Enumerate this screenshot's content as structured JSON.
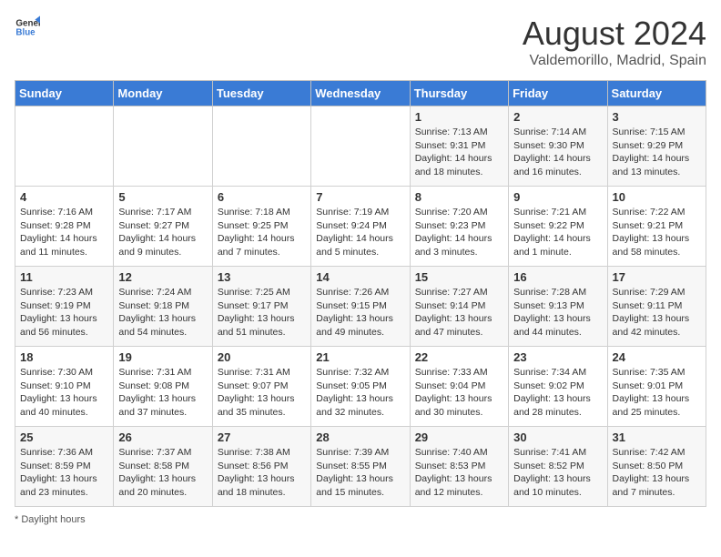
{
  "logo": {
    "text_general": "General",
    "text_blue": "Blue"
  },
  "header": {
    "month": "August 2024",
    "location": "Valdemorillo, Madrid, Spain"
  },
  "days_of_week": [
    "Sunday",
    "Monday",
    "Tuesday",
    "Wednesday",
    "Thursday",
    "Friday",
    "Saturday"
  ],
  "footer": {
    "note": "Daylight hours"
  },
  "weeks": [
    [
      {
        "day": "",
        "info": ""
      },
      {
        "day": "",
        "info": ""
      },
      {
        "day": "",
        "info": ""
      },
      {
        "day": "",
        "info": ""
      },
      {
        "day": "1",
        "info": "Sunrise: 7:13 AM\nSunset: 9:31 PM\nDaylight: 14 hours\nand 18 minutes."
      },
      {
        "day": "2",
        "info": "Sunrise: 7:14 AM\nSunset: 9:30 PM\nDaylight: 14 hours\nand 16 minutes."
      },
      {
        "day": "3",
        "info": "Sunrise: 7:15 AM\nSunset: 9:29 PM\nDaylight: 14 hours\nand 13 minutes."
      }
    ],
    [
      {
        "day": "4",
        "info": "Sunrise: 7:16 AM\nSunset: 9:28 PM\nDaylight: 14 hours\nand 11 minutes."
      },
      {
        "day": "5",
        "info": "Sunrise: 7:17 AM\nSunset: 9:27 PM\nDaylight: 14 hours\nand 9 minutes."
      },
      {
        "day": "6",
        "info": "Sunrise: 7:18 AM\nSunset: 9:25 PM\nDaylight: 14 hours\nand 7 minutes."
      },
      {
        "day": "7",
        "info": "Sunrise: 7:19 AM\nSunset: 9:24 PM\nDaylight: 14 hours\nand 5 minutes."
      },
      {
        "day": "8",
        "info": "Sunrise: 7:20 AM\nSunset: 9:23 PM\nDaylight: 14 hours\nand 3 minutes."
      },
      {
        "day": "9",
        "info": "Sunrise: 7:21 AM\nSunset: 9:22 PM\nDaylight: 14 hours\nand 1 minute."
      },
      {
        "day": "10",
        "info": "Sunrise: 7:22 AM\nSunset: 9:21 PM\nDaylight: 13 hours\nand 58 minutes."
      }
    ],
    [
      {
        "day": "11",
        "info": "Sunrise: 7:23 AM\nSunset: 9:19 PM\nDaylight: 13 hours\nand 56 minutes."
      },
      {
        "day": "12",
        "info": "Sunrise: 7:24 AM\nSunset: 9:18 PM\nDaylight: 13 hours\nand 54 minutes."
      },
      {
        "day": "13",
        "info": "Sunrise: 7:25 AM\nSunset: 9:17 PM\nDaylight: 13 hours\nand 51 minutes."
      },
      {
        "day": "14",
        "info": "Sunrise: 7:26 AM\nSunset: 9:15 PM\nDaylight: 13 hours\nand 49 minutes."
      },
      {
        "day": "15",
        "info": "Sunrise: 7:27 AM\nSunset: 9:14 PM\nDaylight: 13 hours\nand 47 minutes."
      },
      {
        "day": "16",
        "info": "Sunrise: 7:28 AM\nSunset: 9:13 PM\nDaylight: 13 hours\nand 44 minutes."
      },
      {
        "day": "17",
        "info": "Sunrise: 7:29 AM\nSunset: 9:11 PM\nDaylight: 13 hours\nand 42 minutes."
      }
    ],
    [
      {
        "day": "18",
        "info": "Sunrise: 7:30 AM\nSunset: 9:10 PM\nDaylight: 13 hours\nand 40 minutes."
      },
      {
        "day": "19",
        "info": "Sunrise: 7:31 AM\nSunset: 9:08 PM\nDaylight: 13 hours\nand 37 minutes."
      },
      {
        "day": "20",
        "info": "Sunrise: 7:31 AM\nSunset: 9:07 PM\nDaylight: 13 hours\nand 35 minutes."
      },
      {
        "day": "21",
        "info": "Sunrise: 7:32 AM\nSunset: 9:05 PM\nDaylight: 13 hours\nand 32 minutes."
      },
      {
        "day": "22",
        "info": "Sunrise: 7:33 AM\nSunset: 9:04 PM\nDaylight: 13 hours\nand 30 minutes."
      },
      {
        "day": "23",
        "info": "Sunrise: 7:34 AM\nSunset: 9:02 PM\nDaylight: 13 hours\nand 28 minutes."
      },
      {
        "day": "24",
        "info": "Sunrise: 7:35 AM\nSunset: 9:01 PM\nDaylight: 13 hours\nand 25 minutes."
      }
    ],
    [
      {
        "day": "25",
        "info": "Sunrise: 7:36 AM\nSunset: 8:59 PM\nDaylight: 13 hours\nand 23 minutes."
      },
      {
        "day": "26",
        "info": "Sunrise: 7:37 AM\nSunset: 8:58 PM\nDaylight: 13 hours\nand 20 minutes."
      },
      {
        "day": "27",
        "info": "Sunrise: 7:38 AM\nSunset: 8:56 PM\nDaylight: 13 hours\nand 18 minutes."
      },
      {
        "day": "28",
        "info": "Sunrise: 7:39 AM\nSunset: 8:55 PM\nDaylight: 13 hours\nand 15 minutes."
      },
      {
        "day": "29",
        "info": "Sunrise: 7:40 AM\nSunset: 8:53 PM\nDaylight: 13 hours\nand 12 minutes."
      },
      {
        "day": "30",
        "info": "Sunrise: 7:41 AM\nSunset: 8:52 PM\nDaylight: 13 hours\nand 10 minutes."
      },
      {
        "day": "31",
        "info": "Sunrise: 7:42 AM\nSunset: 8:50 PM\nDaylight: 13 hours\nand 7 minutes."
      }
    ]
  ]
}
